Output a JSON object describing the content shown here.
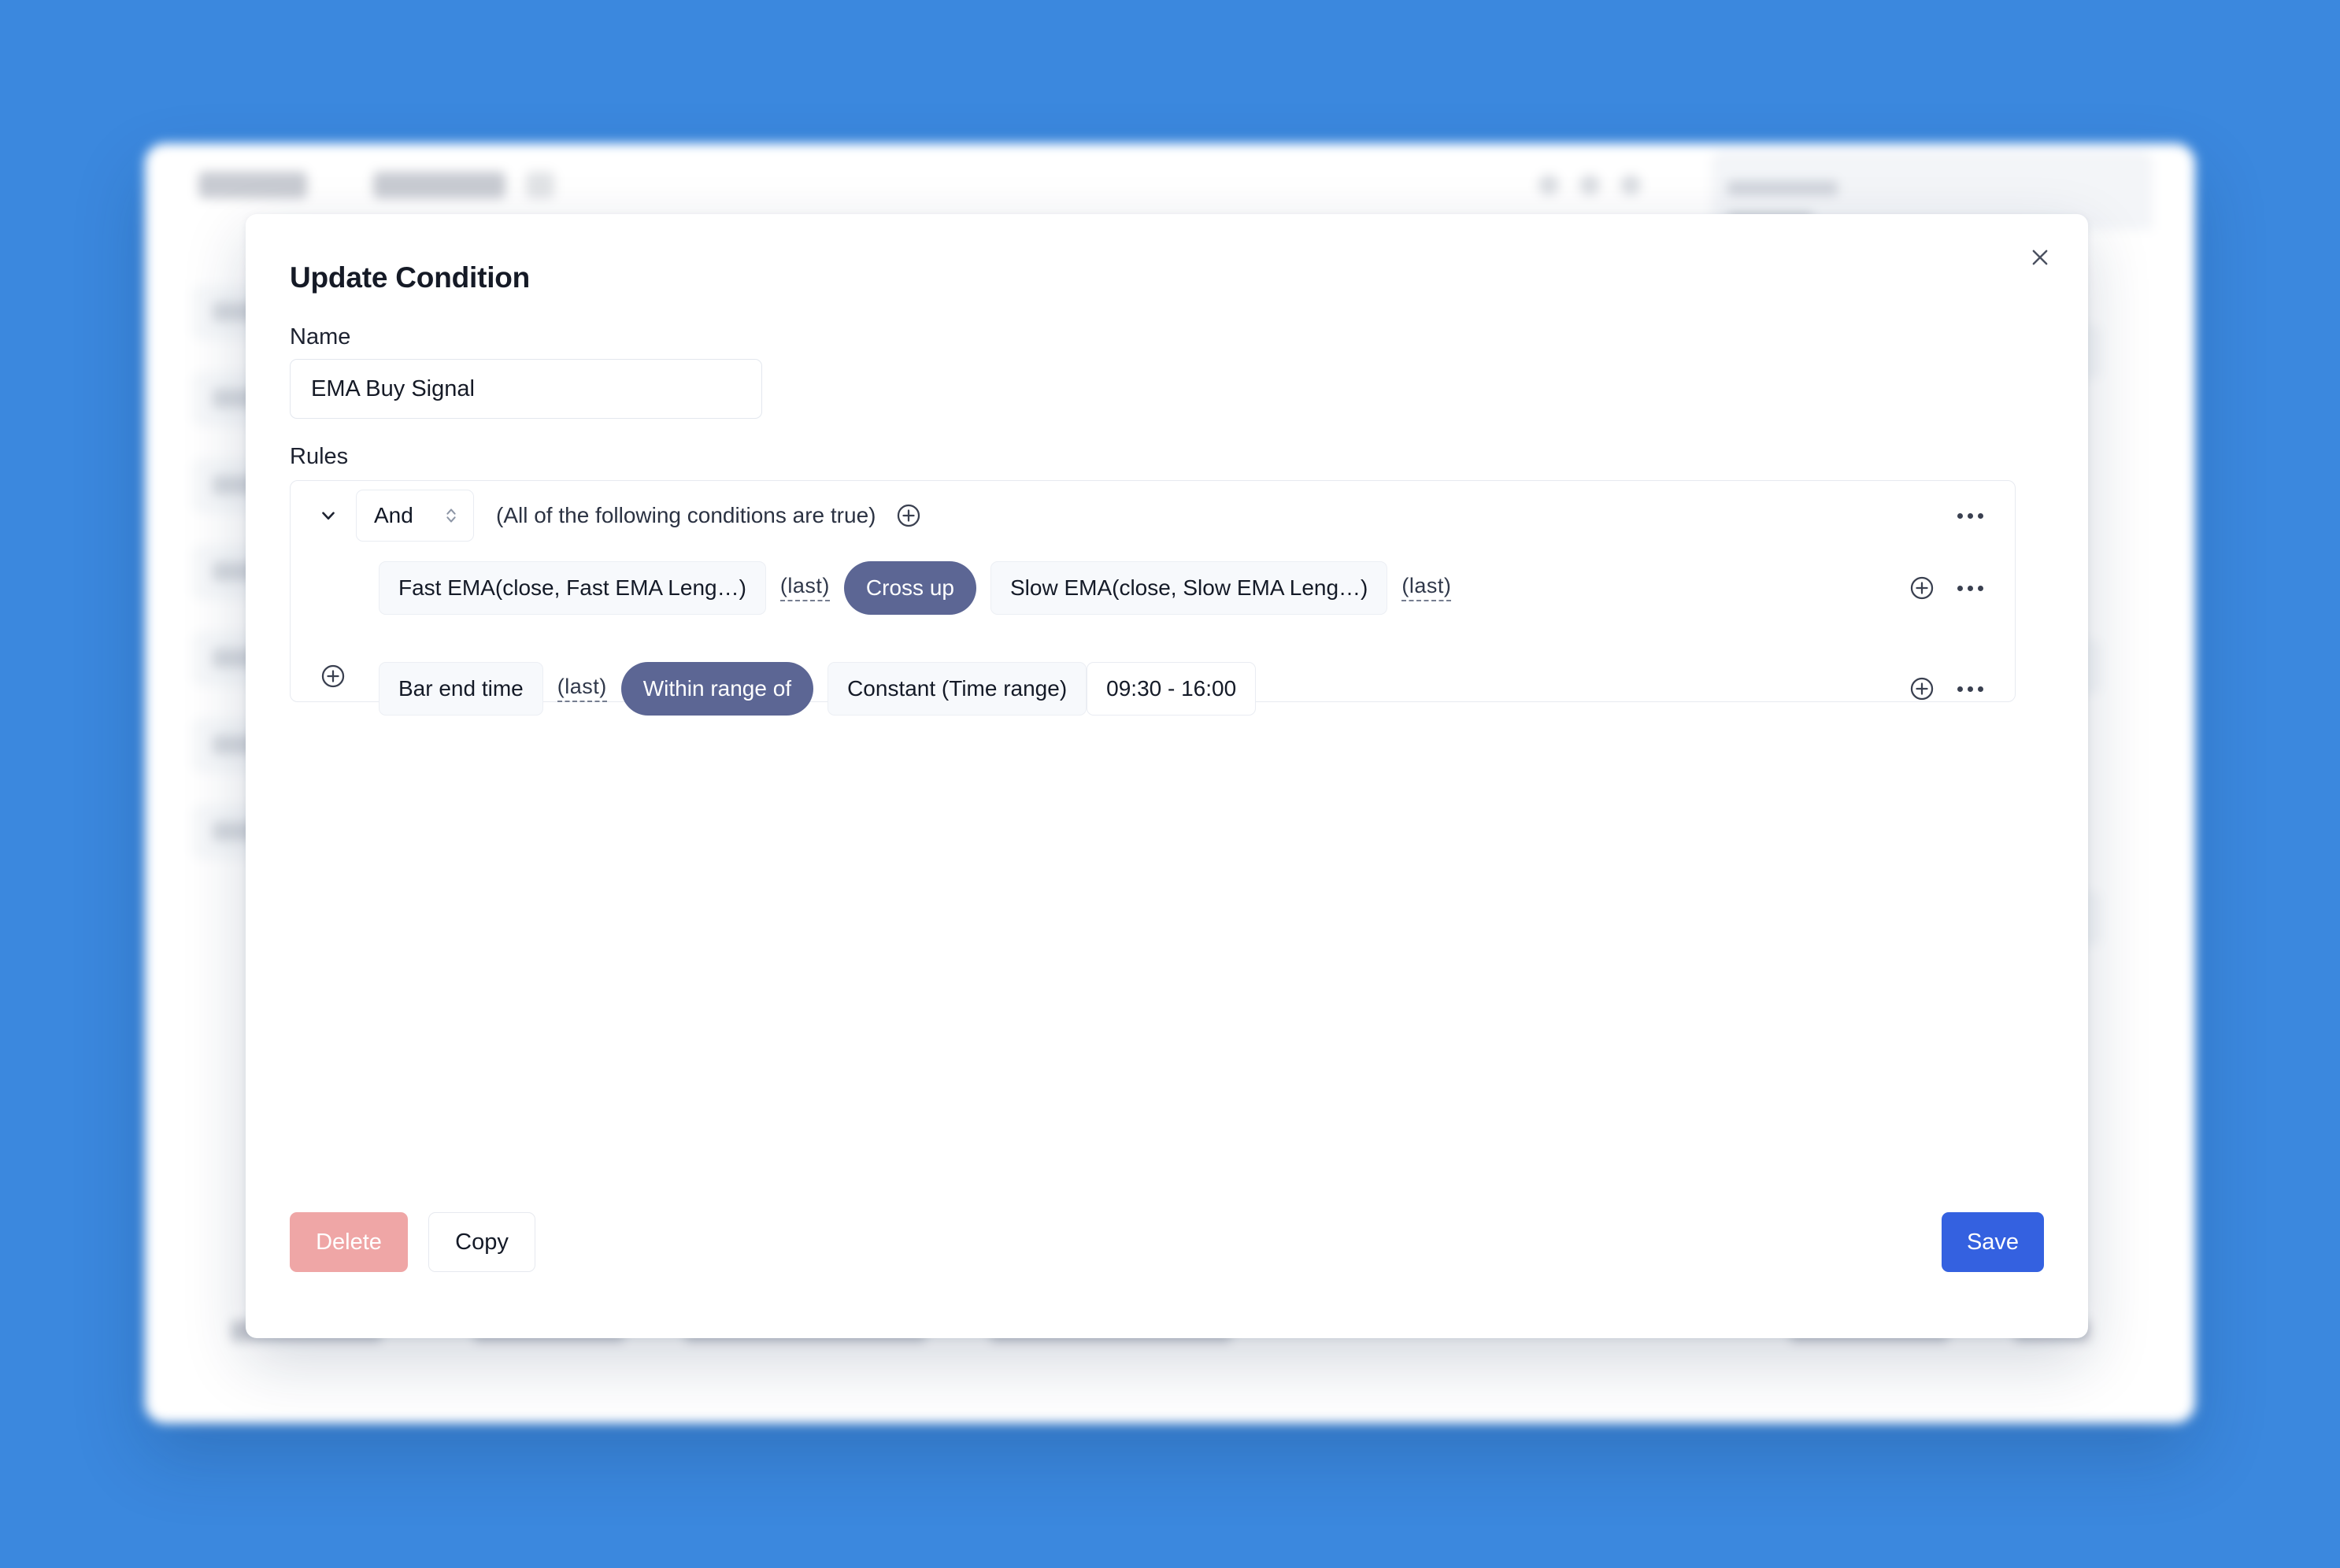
{
  "theme": {
    "page_background": "#3b88de",
    "operator_chip_color": "#5c6694",
    "save_button_color": "#3461e0",
    "delete_button_color": "#efa6a6"
  },
  "modal": {
    "title": "Update Condition",
    "close_icon": "close-icon",
    "name": {
      "label": "Name",
      "value": "EMA Buy Signal",
      "placeholder": "Name"
    },
    "rules": {
      "label": "Rules",
      "group": {
        "collapse_icon": "chevron-down-icon",
        "logic_operator": "And",
        "logic_stepper_icon": "chevron-up-down-icon",
        "description": "(All of the following conditions are true)",
        "add_group_icon": "circle-plus-icon",
        "menu_icon": "ellipsis-icon"
      },
      "rows": [
        {
          "left_operand": "Fast EMA(close, Fast EMA Leng…)",
          "left_modifier": "(last)",
          "operator": "Cross up",
          "right_operand": "Slow EMA(close, Slow EMA Leng…)",
          "right_modifier": "(last)",
          "extra_value": null,
          "add_icon": "circle-plus-icon",
          "menu_icon": "ellipsis-icon"
        },
        {
          "left_operand": "Bar end time",
          "left_modifier": "(last)",
          "operator": "Within range of",
          "right_operand": "Constant (Time range)",
          "right_modifier": null,
          "extra_value": "09:30  -  16:00",
          "add_icon": "circle-plus-icon",
          "menu_icon": "ellipsis-icon"
        }
      ],
      "add_rule_icon": "circle-plus-icon"
    },
    "footer": {
      "delete_label": "Delete",
      "copy_label": "Copy",
      "save_label": "Save"
    }
  }
}
